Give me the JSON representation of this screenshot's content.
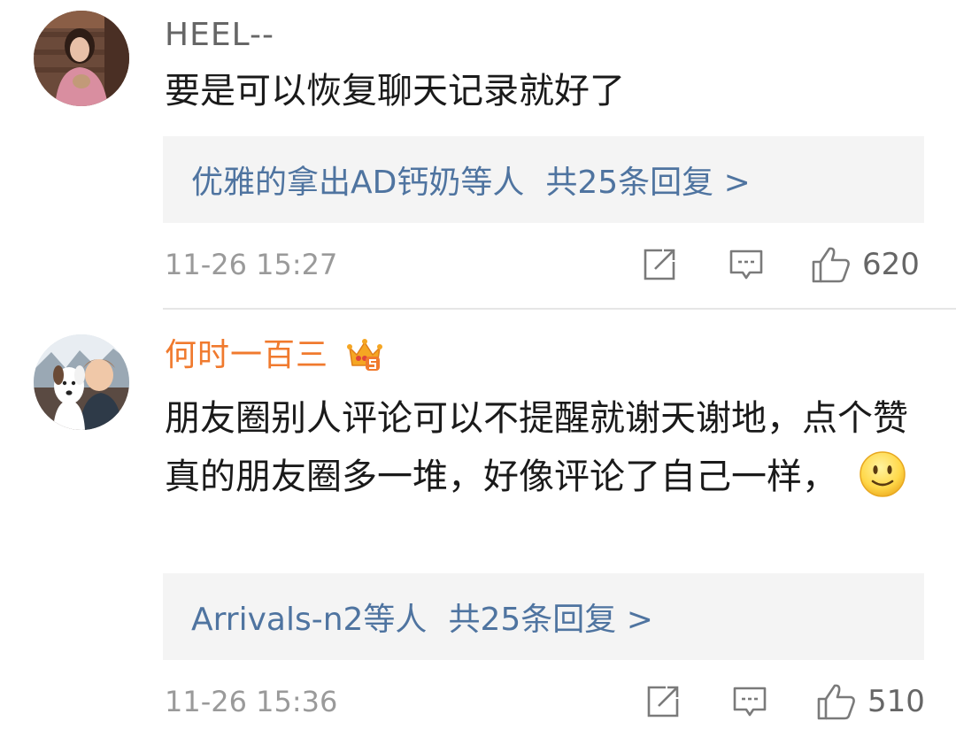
{
  "comments": [
    {
      "username": "HEEL--",
      "avatar_icon": "avatar-person-photo",
      "vip_badge": false,
      "text": "要是可以恢复聊天记录就好了",
      "replies": {
        "preview": "优雅的拿出AD钙奶等人",
        "count_label": "共25条回复 >"
      },
      "timestamp": "11-26 15:27",
      "actions": {
        "share_icon": "share-icon",
        "comment_icon": "comment-icon",
        "like_icon": "thumbs-up-icon",
        "like_count": "620"
      }
    },
    {
      "username": "何时一百三",
      "avatar_icon": "avatar-child-and-dog-photo",
      "vip_badge": true,
      "badge_icon": "crown-vip-icon",
      "text": "朋友圈别人评论可以不提醒就谢天谢地，点个赞真的朋友圈多一堆，好像评论了自己一样，",
      "emoji": "smile-emoji",
      "replies": {
        "preview": "Arrivals-n2等人",
        "count_label": "共25条回复 >"
      },
      "timestamp": "11-26 15:36",
      "actions": {
        "share_icon": "share-icon",
        "comment_icon": "comment-icon",
        "like_icon": "thumbs-up-icon",
        "like_count": "510"
      }
    }
  ],
  "colors": {
    "username": "#666666",
    "vip_username": "#f07a2e",
    "link_blue": "#4f74a0",
    "body_text": "#1a1a1a",
    "meta_gray": "#9a9a9a",
    "reply_bg": "#f4f4f4",
    "divider": "#e6e6e6"
  }
}
